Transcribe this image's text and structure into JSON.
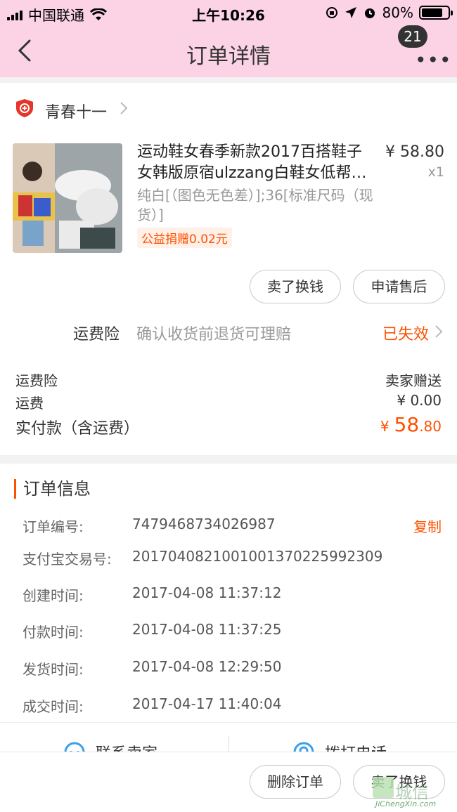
{
  "status_bar": {
    "carrier": "中国联通",
    "time": "上午10:26",
    "battery_percent": "80%",
    "battery_level": 0.8
  },
  "nav": {
    "title": "订单详情",
    "badge_count": "21",
    "more_icon": "•••"
  },
  "shop": {
    "name": "青春十一",
    "logo_icon": "enterprise-shield-icon"
  },
  "product": {
    "title_line1": "运动鞋女春季新款2017百搭鞋子",
    "title_line2": "女韩版原宿ulzzang白鞋女低帮…",
    "price": "¥ 58.80",
    "quantity": "x1",
    "sku": "纯白[（图色无色差）];36[标准尺码（现货）]",
    "charity": "公益捐赠0.02元"
  },
  "item_actions": {
    "resell": "卖了换钱",
    "after_sale": "申请售后"
  },
  "insurance": {
    "label": "运费险",
    "desc": "确认收货前退货可理赔",
    "status": "已失效"
  },
  "fees": {
    "insurance_label": "运费险",
    "insurance_value": "卖家赠送",
    "shipping_label": "运费",
    "shipping_value": "¥ 0.00",
    "paid_label": "实付款（含运费）",
    "paid_currency": "¥",
    "paid_integer": "58",
    "paid_decimal": ".80"
  },
  "order_info": {
    "title": "订单信息",
    "copy_label": "复制",
    "rows": [
      {
        "key": "订单编号:",
        "value": "7479468734026987"
      },
      {
        "key": "支付宝交易号:",
        "value": "2017040821001001370225992309"
      },
      {
        "key": "创建时间:",
        "value": "2017-04-08 11:37:12"
      },
      {
        "key": "付款时间:",
        "value": "2017-04-08 11:37:25"
      },
      {
        "key": "发货时间:",
        "value": "2017-04-08 12:29:50"
      },
      {
        "key": "成交时间:",
        "value": "2017-04-17 11:40:04"
      }
    ]
  },
  "contact": {
    "seller": "联系卖家",
    "call": "拨打电话"
  },
  "bottom_actions": {
    "delete": "删除订单",
    "resell": "卖了换钱"
  },
  "watermark": {
    "text": "城信",
    "sub": "JiChengXin.com"
  },
  "colors": {
    "nav_bg": "#fbd3e5",
    "accent": "#ff5000"
  }
}
